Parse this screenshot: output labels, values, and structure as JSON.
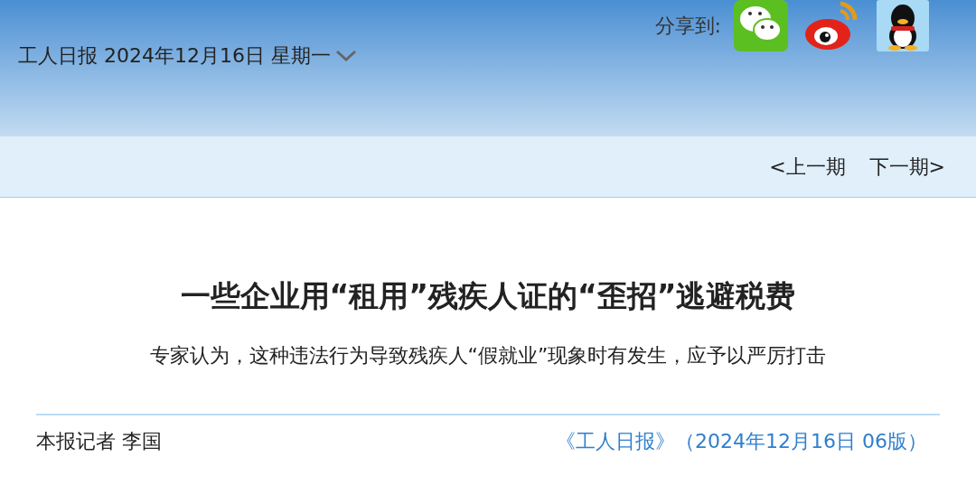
{
  "header": {
    "dateline": "工人日报 2024年12月16日 星期一",
    "share_label": "分享到:"
  },
  "issue_nav": {
    "prev": "<上一期",
    "next": "下一期>"
  },
  "article": {
    "title": "一些企业用“租用”残疾人证的“歪招”逃避税费",
    "subtitle": "专家认为，这种违法行为导致残疾人“假就业”现象时有发生，应予以严厉打击",
    "byline": "本报记者 李国",
    "source": "《工人日报》（2024年12月16日 06版）"
  }
}
